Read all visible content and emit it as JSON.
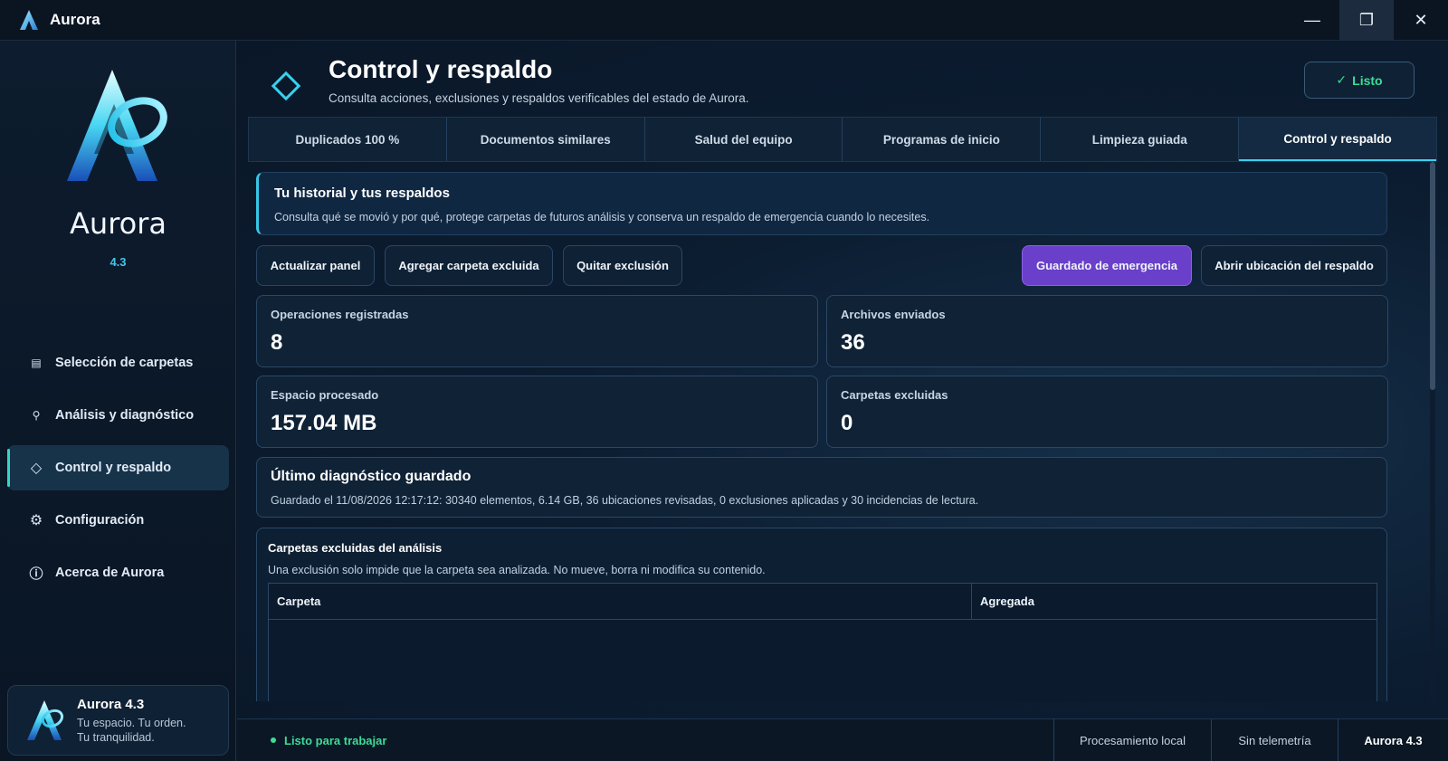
{
  "window": {
    "title": "Aurora",
    "controls": {
      "minimize": "—",
      "maximize": "❐",
      "close": "✕"
    }
  },
  "sidebar": {
    "brand_name": "Aurora",
    "version": "4.3",
    "items": [
      {
        "label": "Selección de carpetas",
        "icon": "folder-list-icon",
        "glyph": "▤"
      },
      {
        "label": "Análisis y diagnóstico",
        "icon": "search-icon",
        "glyph": "⚲"
      },
      {
        "label": "Control y respaldo",
        "icon": "diamond-icon",
        "glyph": "◇"
      },
      {
        "label": "Configuración",
        "icon": "gear-icon",
        "glyph": "⚙"
      },
      {
        "label": "Acerca de Aurora",
        "icon": "info-icon",
        "glyph": "ⓘ"
      }
    ],
    "active_index": 2,
    "card": {
      "title": "Aurora 4.3",
      "line1": "Tu espacio. Tu orden.",
      "line2": "Tu tranquilidad."
    }
  },
  "header": {
    "title": "Control y respaldo",
    "subtitle": "Consulta acciones, exclusiones y respaldos verificables del estado de Aurora.",
    "ready_check": "✓",
    "ready_label": "Listo"
  },
  "tabs": [
    "Duplicados 100 %",
    "Documentos similares",
    "Salud del equipo",
    "Programas de inicio",
    "Limpieza guiada",
    "Control y respaldo"
  ],
  "active_tab": 5,
  "banner": {
    "title": "Tu historial y tus respaldos",
    "text": "Consulta qué se movió y por qué, protege carpetas de futuros análisis y conserva un respaldo de emergencia cuando lo necesites."
  },
  "actions": {
    "refresh": "Actualizar panel",
    "add_excluded": "Agregar carpeta excluida",
    "remove_exclusion": "Quitar exclusión",
    "emergency_save": "Guardado de emergencia",
    "open_backup": "Abrir ubicación del respaldo"
  },
  "stats": {
    "operations": {
      "label": "Operaciones registradas",
      "value": "8"
    },
    "files_sent": {
      "label": "Archivos enviados",
      "value": "36"
    },
    "space": {
      "label": "Espacio procesado",
      "value": "157.04 MB"
    },
    "excluded": {
      "label": "Carpetas excluidas",
      "value": "0"
    }
  },
  "diagnostic": {
    "title": "Último diagnóstico guardado",
    "text": "Guardado el 11/08/2026 12:17:12: 30340 elementos, 6.14 GB, 36 ubicaciones revisadas, 0 exclusiones aplicadas y 30 incidencias de lectura."
  },
  "exclusions": {
    "title": "Carpetas excluidas del análisis",
    "text": "Una exclusión solo impide que la carpeta sea analizada. No mueve, borra ni modifica su contenido.",
    "columns": [
      "Carpeta",
      "Agregada"
    ]
  },
  "statusbar": {
    "ready": "Listo para trabajar",
    "local": "Procesamiento local",
    "telemetry": "Sin telemetría",
    "version": "Aurora 4.3"
  },
  "colors": {
    "accent": "#38d0ee",
    "success": "#3ddc97",
    "primary_button": "#6a3fc9"
  }
}
